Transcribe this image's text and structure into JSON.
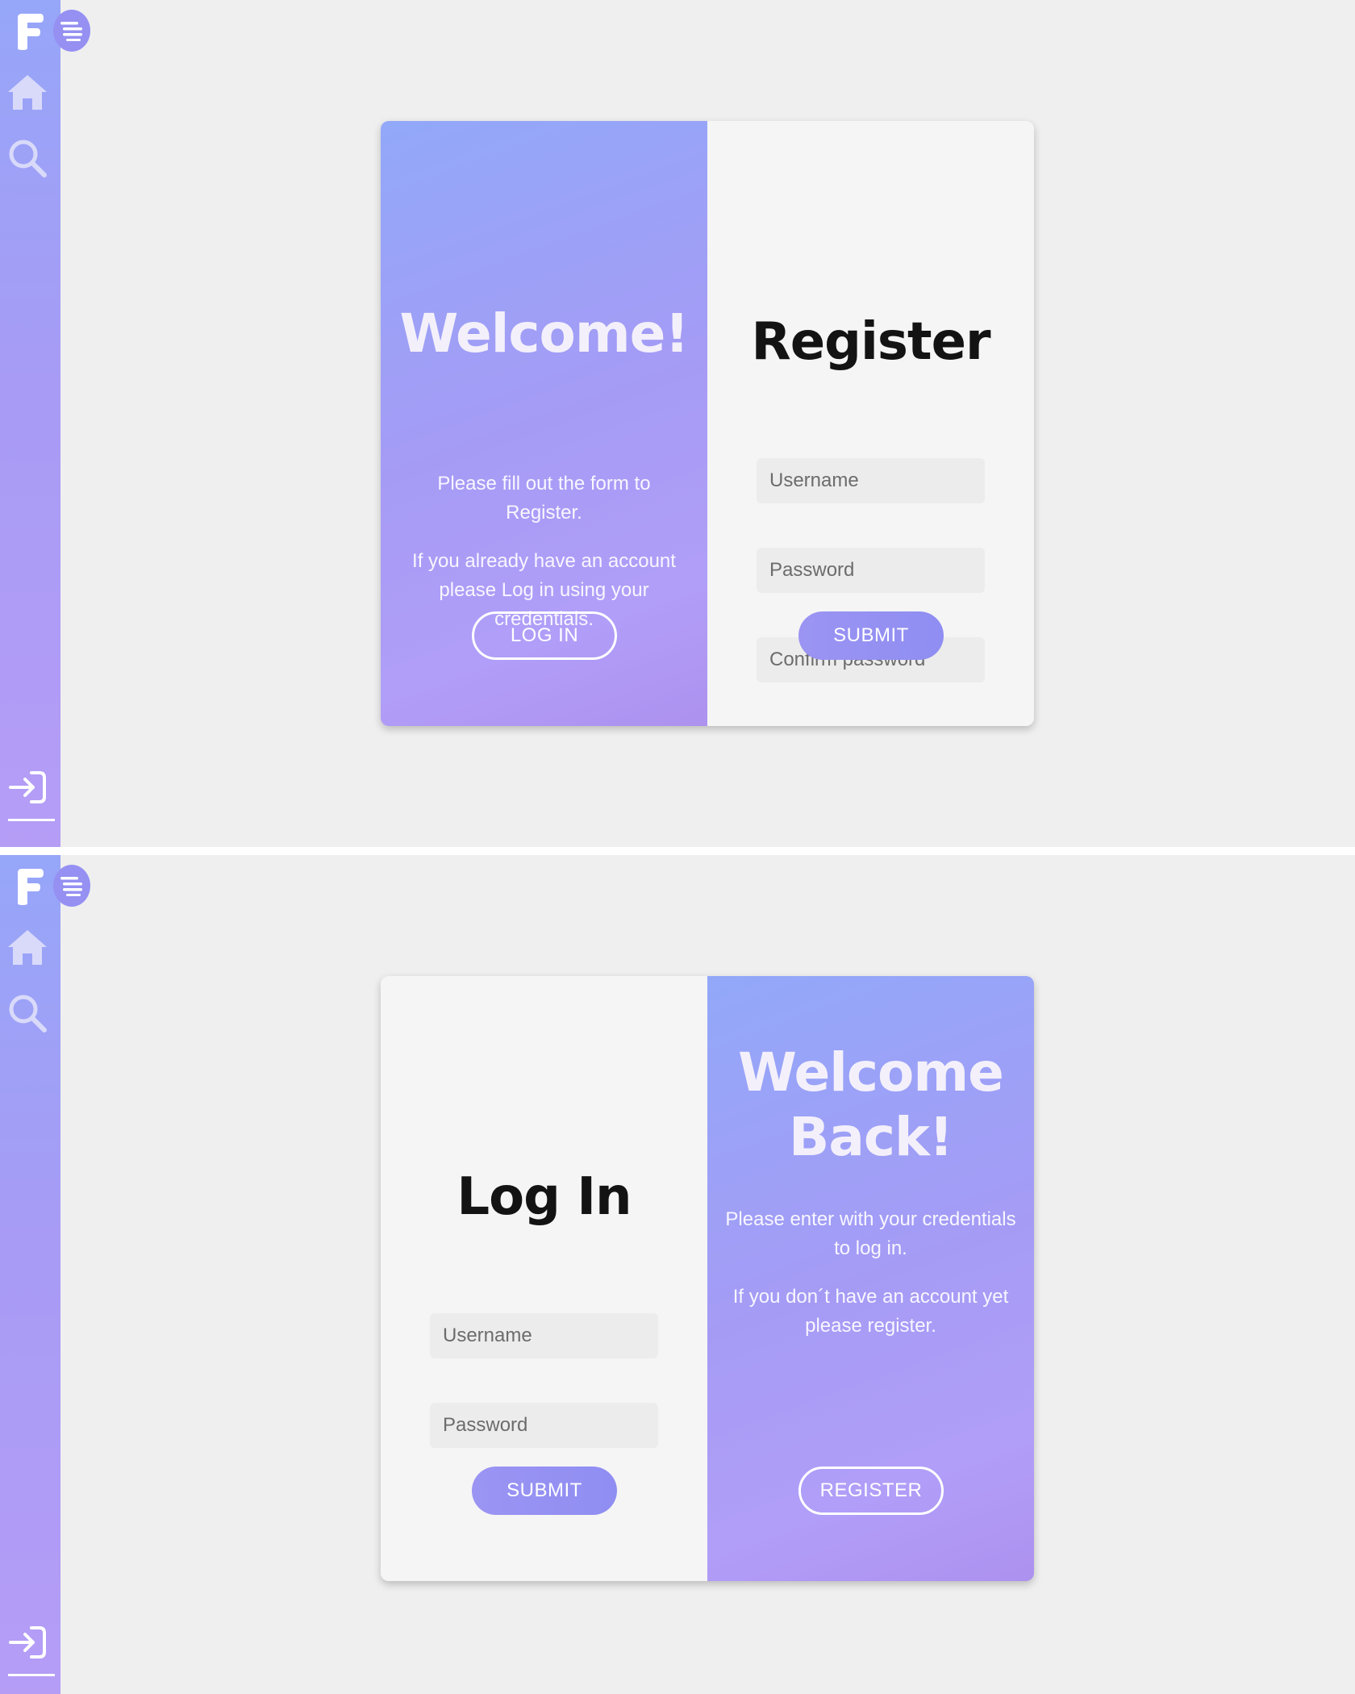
{
  "sidebar": {
    "logo_letter": "F",
    "icons": [
      "logo-f-icon",
      "menu-icon",
      "home-icon",
      "search-icon",
      "login-icon"
    ]
  },
  "register_screen": {
    "welcome_title": "Welcome!",
    "welcome_text_1": "Please fill out the form to Register.",
    "welcome_text_2": "If you already have an account please Log in using your credentials.",
    "login_button": "LOG IN",
    "form_title": "Register",
    "username_placeholder": "Username",
    "password_placeholder": "Password",
    "confirm_placeholder": "Confirm password",
    "submit_button": "SUBMIT"
  },
  "login_screen": {
    "form_title": "Log In",
    "username_placeholder": "Username",
    "password_placeholder": "Password",
    "submit_button": "SUBMIT",
    "welcome_title_line1": "Welcome",
    "welcome_title_line2": "Back!",
    "welcome_text_1": "Please enter with your credentials to log in.",
    "welcome_text_2": "If you don´t have an account yet please register.",
    "register_button": "REGISTER"
  },
  "colors": {
    "gradient_start": "#92a8f9",
    "gradient_end": "#b19ef8",
    "button_fill": "#9590f2",
    "page_background": "#efefef"
  }
}
